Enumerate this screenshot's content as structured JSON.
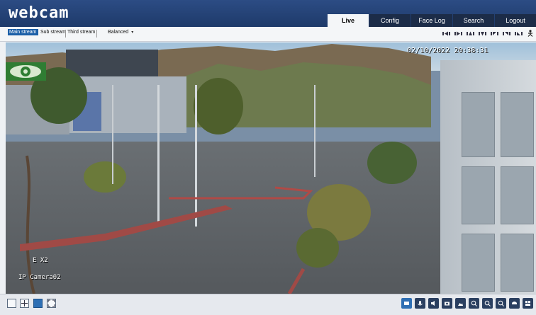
{
  "app": {
    "logo": "webcam"
  },
  "nav": {
    "tabs": [
      "Live",
      "Config",
      "Face Log",
      "Search",
      "Logout"
    ],
    "active": "Live"
  },
  "toolbar": {
    "streams": [
      "Main stream",
      "Sub stream",
      "Third stream"
    ],
    "active_stream": "Main stream",
    "quality_select": "Balanced"
  },
  "video": {
    "timestamp": "02/10/2022 20:38:31",
    "zoom_label": "E X2",
    "camera_name": "IP Camera02"
  },
  "colors": {
    "header": "#24457a",
    "active_tab": "#f4f6f8",
    "accent": "#2e6fb4"
  },
  "icons": {
    "top_controls": [
      "ptz-left-icon",
      "ptz-right-icon",
      "ptz-up-icon",
      "ptz-down-icon",
      "ptz-left-up-icon",
      "ptz-right-up-icon",
      "ptz-left-down-icon",
      "ptz-right-down-icon",
      "person-icon"
    ],
    "bottom_left": [
      "fit-window-icon",
      "move-icon",
      "original-size-icon",
      "fullscreen-icon"
    ],
    "bottom_right": [
      "record-icon",
      "talk-icon",
      "audio-icon",
      "snapshot-icon",
      "image-icon",
      "zoom-in-icon",
      "zoom-out-icon",
      "zoom-reset-icon",
      "ptz-icon",
      "layout-icon"
    ]
  }
}
